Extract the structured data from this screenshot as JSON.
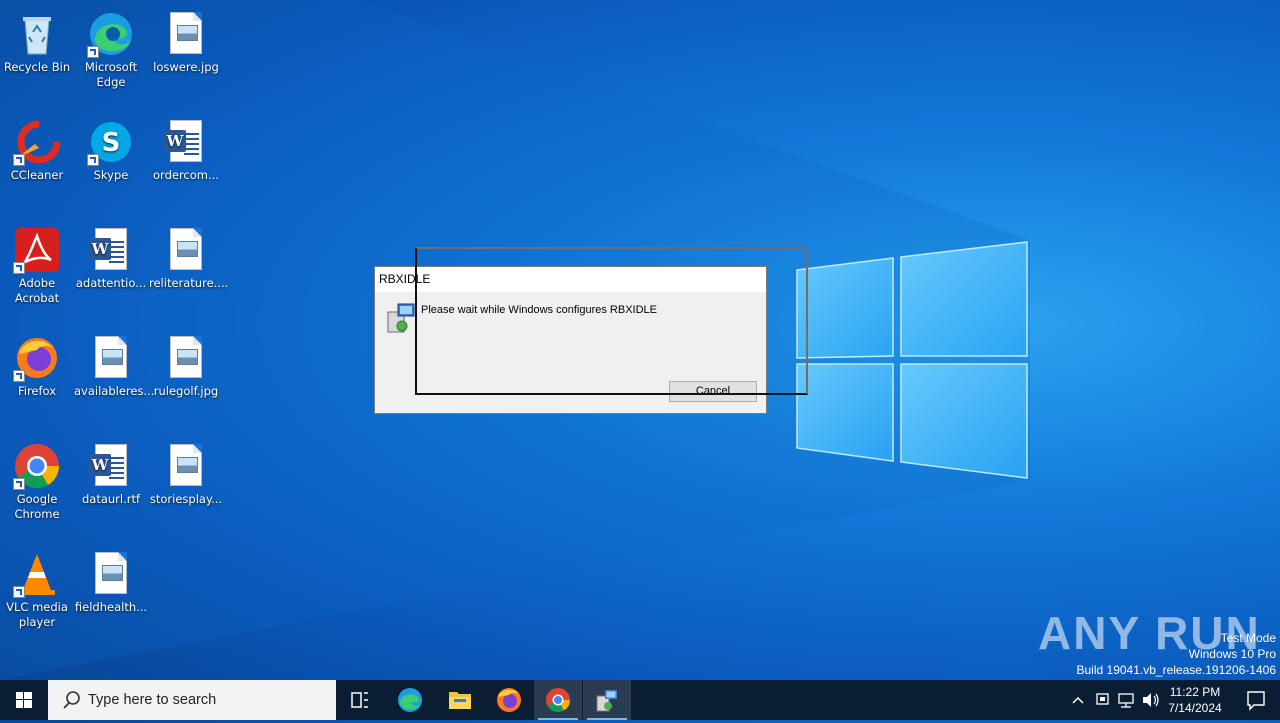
{
  "desktop": {
    "icons": [
      {
        "label": "Recycle Bin"
      },
      {
        "label": "Microsoft Edge"
      },
      {
        "label": "loswere.jpg"
      },
      {
        "label": "CCleaner"
      },
      {
        "label": "Skype"
      },
      {
        "label": "ordercom..."
      },
      {
        "label": "Adobe Acrobat"
      },
      {
        "label": "adattentio..."
      },
      {
        "label": "reliterature...."
      },
      {
        "label": "Firefox"
      },
      {
        "label": "availableres..."
      },
      {
        "label": "rulegolf.jpg"
      },
      {
        "label": "Google Chrome"
      },
      {
        "label": "dataurl.rtf"
      },
      {
        "label": "storiesplay..."
      },
      {
        "label": "VLC media player"
      },
      {
        "label": "fieldhealth..."
      }
    ]
  },
  "dialog": {
    "title": "RBXIDLE",
    "message": "Please wait while Windows configures RBXIDLE",
    "cancel_label": "Cancel"
  },
  "watermark": {
    "brand": "ANY RUN",
    "line1": "Test Mode",
    "line2": "Windows 10 Pro",
    "line3": "Build 19041.vb_release.191206-1406"
  },
  "taskbar": {
    "search_placeholder": "Type here to search",
    "time": "11:22 PM",
    "date": "7/14/2024"
  },
  "colors": {
    "desktop_accent": "#1177d8",
    "taskbar": "#0b1d33",
    "active_indicator": "#76b9ed"
  }
}
